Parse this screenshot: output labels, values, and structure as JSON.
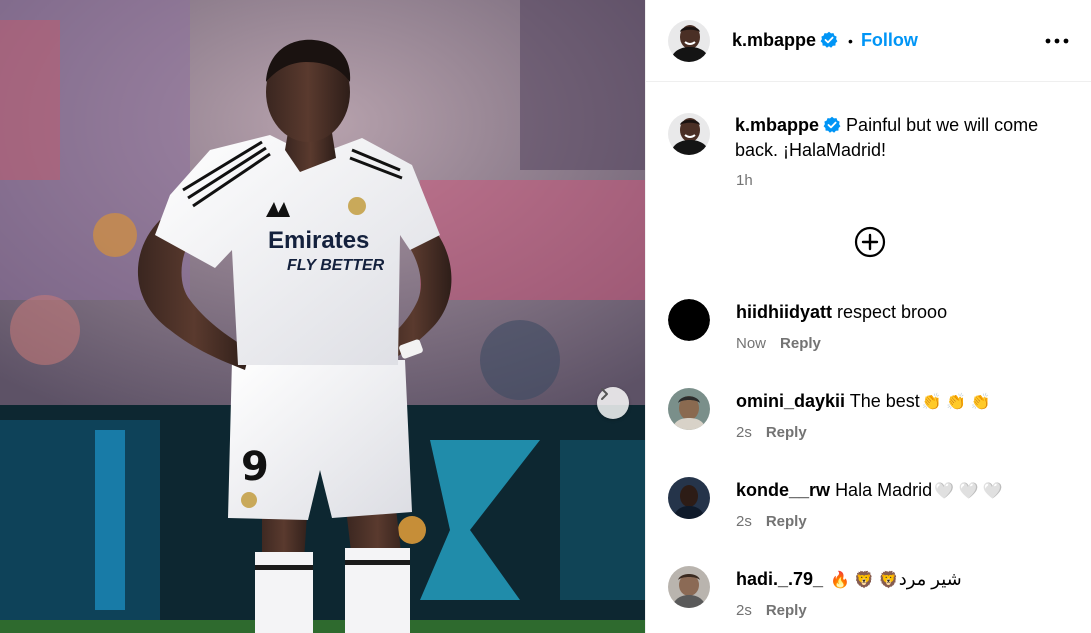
{
  "post": {
    "author": "k.mbappe",
    "follow_label": "Follow",
    "separator": "•",
    "caption": "Painful but we will come back. ¡HalaMadrid!",
    "caption_time": "1h",
    "jersey_sponsor_line1": "Emirates",
    "jersey_sponsor_line2": "FLY BETTER",
    "shorts_number": "9"
  },
  "comments": [
    {
      "user": "hiidhiidyatt",
      "text": "respect brooo",
      "time": "Now",
      "reply": "Reply"
    },
    {
      "user": "omini_daykii",
      "text": "The best",
      "emoji": "👏 👏 👏",
      "time": "2s",
      "reply": "Reply"
    },
    {
      "user": "konde__rw",
      "text": "Hala Madrid",
      "emoji": "🤍 🤍 🤍",
      "time": "2s",
      "reply": "Reply"
    },
    {
      "user": "hadi._.79_",
      "text": "شیر مرد",
      "emoji": "🔥 🦁 🦁",
      "time": "2s",
      "reply": "Reply"
    }
  ],
  "icons": {
    "verified": "verified-badge-icon",
    "more": "more-options-icon",
    "add": "add-comment-icon",
    "next": "chevron-right-icon"
  },
  "colors": {
    "link_blue": "#0095f6",
    "muted_gray": "#737373",
    "divider": "#efefef"
  }
}
